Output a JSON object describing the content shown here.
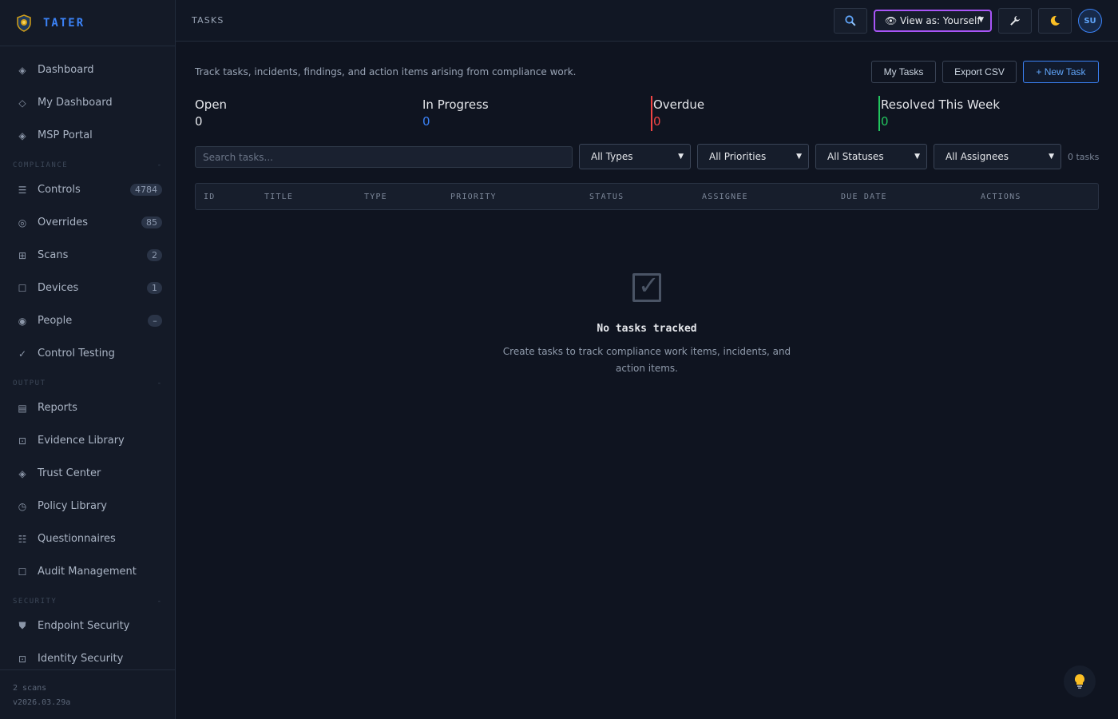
{
  "brand": {
    "name": "TATER"
  },
  "sidebar": {
    "items_top": [
      {
        "label": "Dashboard",
        "icon": "◈"
      },
      {
        "label": "My Dashboard",
        "icon": "◇"
      },
      {
        "label": "MSP Portal",
        "icon": "◈"
      }
    ],
    "compliance": {
      "title": "COMPLIANCE",
      "items": [
        {
          "label": "Controls",
          "icon": "☰",
          "badge": "4784"
        },
        {
          "label": "Overrides",
          "icon": "◎",
          "badge": "85"
        },
        {
          "label": "Scans",
          "icon": "⊞",
          "badge": "2"
        },
        {
          "label": "Devices",
          "icon": "☐",
          "badge": "1"
        },
        {
          "label": "People",
          "icon": "◉",
          "badge": "–"
        },
        {
          "label": "Control Testing",
          "icon": "✓"
        }
      ]
    },
    "output": {
      "title": "OUTPUT",
      "items": [
        {
          "label": "Reports",
          "icon": "▤"
        },
        {
          "label": "Evidence Library",
          "icon": "⊡"
        },
        {
          "label": "Trust Center",
          "icon": "◈"
        },
        {
          "label": "Policy Library",
          "icon": "◷"
        },
        {
          "label": "Questionnaires",
          "icon": "☷"
        },
        {
          "label": "Audit Management",
          "icon": "☐"
        }
      ]
    },
    "security": {
      "title": "SECURITY",
      "items": [
        {
          "label": "Endpoint Security",
          "icon": "⛊"
        },
        {
          "label": "Identity Security",
          "icon": "⊡"
        }
      ]
    },
    "section_marker": "-",
    "footer": {
      "scans": "2 scans",
      "version": "v2026.03.29a"
    }
  },
  "topbar": {
    "title": "TASKS",
    "view_as": "👁 View as: Yourself",
    "avatar": "SU"
  },
  "main": {
    "description": "Track tasks, incidents, findings, and action items arising from compliance work.",
    "buttons": {
      "my_tasks": "My Tasks",
      "export_csv": "Export CSV",
      "new_task": "+ New Task"
    },
    "stats": [
      {
        "label": "Open",
        "value": "0",
        "color": "#e5e7eb"
      },
      {
        "label": "In Progress",
        "value": "0",
        "color": "#3b82f6"
      },
      {
        "label": "Overdue",
        "value": "0",
        "color": "#ef4444"
      },
      {
        "label": "Resolved This Week",
        "value": "0",
        "color": "#22c55e"
      }
    ],
    "search_placeholder": "Search tasks...",
    "filters": {
      "types": "All Types",
      "priorities": "All Priorities",
      "statuses": "All Statuses",
      "assignees": "All Assignees"
    },
    "count": "0 tasks",
    "columns": [
      "ID",
      "TITLE",
      "TYPE",
      "PRIORITY",
      "STATUS",
      "ASSIGNEE",
      "DUE DATE",
      "ACTIONS"
    ],
    "empty": {
      "title": "No tasks tracked",
      "text": "Create tasks to track compliance work items, incidents, and action items."
    }
  },
  "colors": {
    "accent": "#3b82f6",
    "view_border": "#a855f7",
    "danger": "#ef4444",
    "success": "#22c55e"
  }
}
